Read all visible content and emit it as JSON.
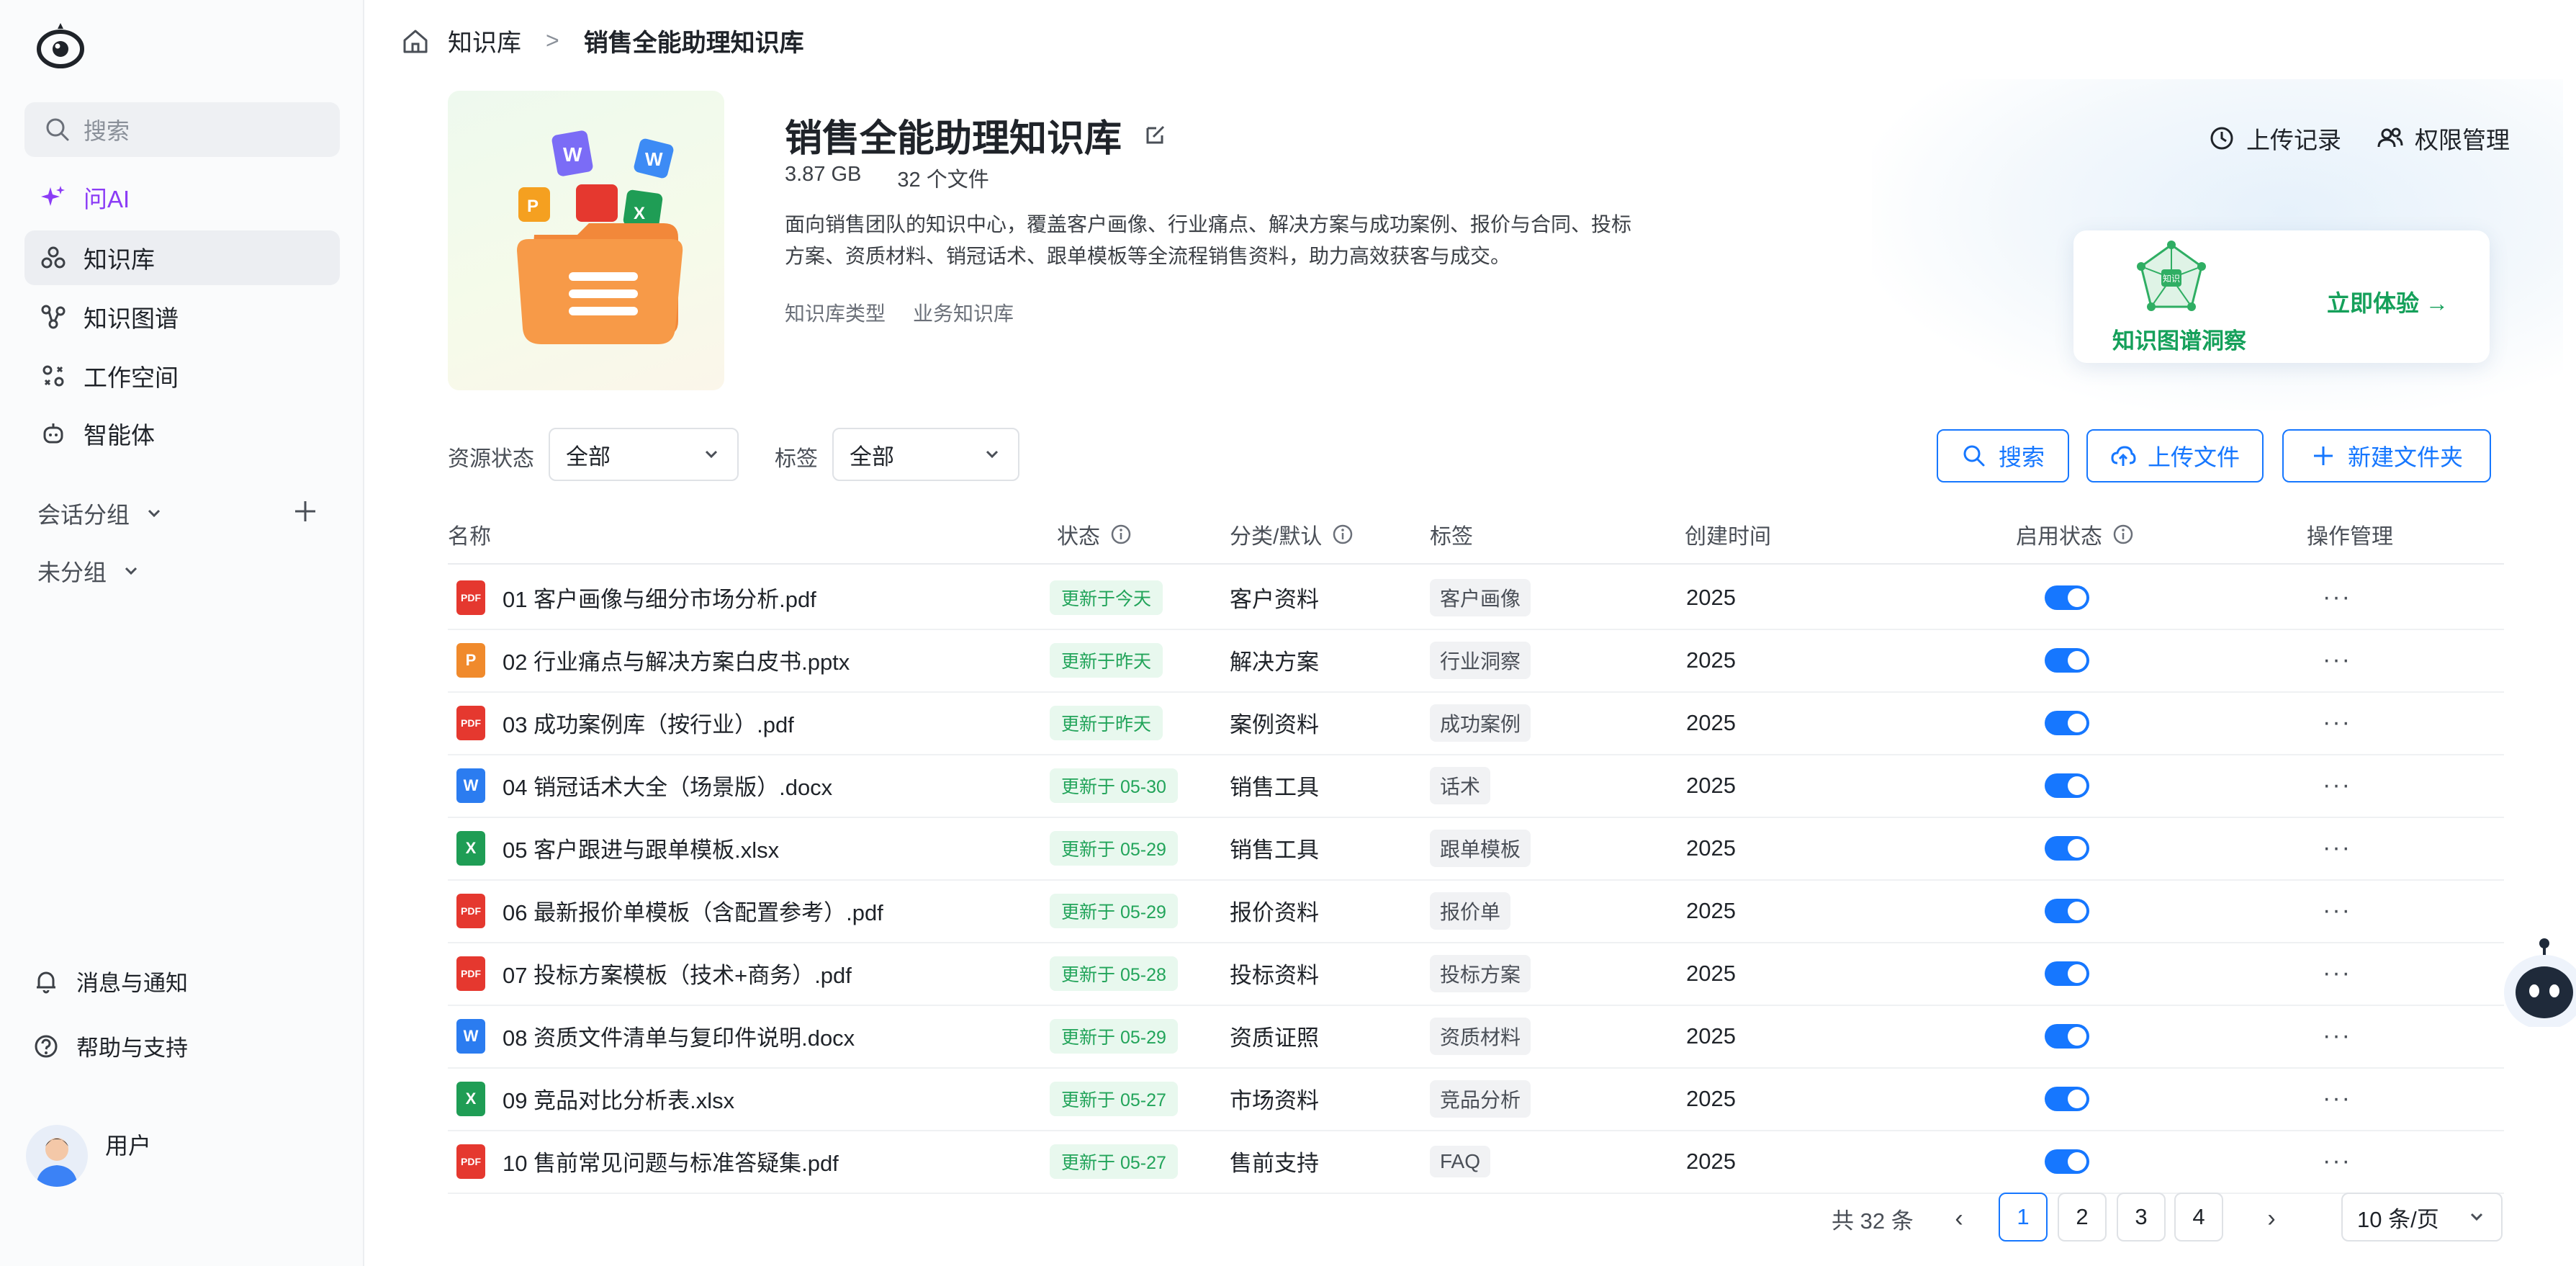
{
  "sidebar": {
    "search_placeholder": "搜索",
    "items": [
      {
        "label": "问AI",
        "icon": "sparkle-icon"
      },
      {
        "label": "知识库",
        "icon": "knowledge-base-icon"
      },
      {
        "label": "知识图谱",
        "icon": "graph-icon"
      },
      {
        "label": "工作空间",
        "icon": "workspace-icon"
      },
      {
        "label": "智能体",
        "icon": "agent-icon"
      }
    ],
    "groups": [
      {
        "label": "会话分组"
      },
      {
        "label": "未分组"
      }
    ],
    "bottom": [
      {
        "label": "消息与通知",
        "icon": "bell-icon"
      },
      {
        "label": "帮助与支持",
        "icon": "help-icon"
      }
    ],
    "user_name": "用户"
  },
  "breadcrumb": {
    "root": "知识库",
    "separator": ">",
    "current": "销售全能助理知识库"
  },
  "kb": {
    "title": "销售全能助理知识库",
    "size": "3.87 GB",
    "file_count": "32 个文件",
    "description": "面向销售团队的知识中心，覆盖客户画像、行业痛点、解决方案与成功案例、报价与合同、投标方案、资质材料、销冠话术、跟单模板等全流程销售资料，助力高效获客与成交。",
    "type_label": "知识库类型",
    "type_value": "业务知识库",
    "upload_history": "上传记录",
    "permissions": "权限管理",
    "graph_card_label": "知识图谱洞察",
    "graph_card_cta": "立即体验 →",
    "graph_card_center": "知识"
  },
  "filters": {
    "status_label": "资源状态",
    "status_value": "全部",
    "tag_label": "标签",
    "tag_value": "全部"
  },
  "actions": {
    "search": "搜索",
    "upload": "上传文件",
    "new_folder": "新建文件夹"
  },
  "table": {
    "headers": {
      "name": "名称",
      "status": "状态",
      "category": "分类/默认",
      "tag": "标签",
      "created": "创建时间",
      "enabled": "启用状态",
      "ops": "操作管理"
    },
    "rows": [
      {
        "name": "01 客户画像与细分市场分析.pdf",
        "type": "pdf",
        "status": "更新于今天",
        "category": "客户资料",
        "tag": "客户画像",
        "created": "2025",
        "enabled": true
      },
      {
        "name": "02 行业痛点与解决方案白皮书.pptx",
        "type": "pptx",
        "status": "更新于昨天",
        "category": "解决方案",
        "tag": "行业洞察",
        "created": "2025",
        "enabled": true
      },
      {
        "name": "03 成功案例库（按行业）.pdf",
        "type": "pdf",
        "status": "更新于昨天",
        "category": "案例资料",
        "tag": "成功案例",
        "created": "2025",
        "enabled": true
      },
      {
        "name": "04 销冠话术大全（场景版）.docx",
        "type": "docx",
        "status": "更新于 05-30",
        "category": "销售工具",
        "tag": "话术",
        "created": "2025",
        "enabled": true
      },
      {
        "name": "05 客户跟进与跟单模板.xlsx",
        "type": "xlsx",
        "status": "更新于 05-29",
        "category": "销售工具",
        "tag": "跟单模板",
        "created": "2025",
        "enabled": true
      },
      {
        "name": "06 最新报价单模板（含配置参考）.pdf",
        "type": "pdf",
        "status": "更新于 05-29",
        "category": "报价资料",
        "tag": "报价单",
        "created": "2025",
        "enabled": true
      },
      {
        "name": "07 投标方案模板（技术+商务）.pdf",
        "type": "pdf",
        "status": "更新于 05-28",
        "category": "投标资料",
        "tag": "投标方案",
        "created": "2025",
        "enabled": true
      },
      {
        "name": "08 资质文件清单与复印件说明.docx",
        "type": "docx",
        "status": "更新于 05-29",
        "category": "资质证照",
        "tag": "资质材料",
        "created": "2025",
        "enabled": true
      },
      {
        "name": "09 竞品对比分析表.xlsx",
        "type": "xlsx",
        "status": "更新于 05-27",
        "category": "市场资料",
        "tag": "竞品分析",
        "created": "2025",
        "enabled": true
      },
      {
        "name": "10 售前常见问题与标准答疑集.pdf",
        "type": "pdf",
        "status": "更新于 05-27",
        "category": "售前支持",
        "tag": "FAQ",
        "created": "2025",
        "enabled": true
      }
    ],
    "ops_symbol": "···"
  },
  "pagination": {
    "total": "共 32 条",
    "pages": [
      "1",
      "2",
      "3",
      "4"
    ],
    "current": "1",
    "prev": "‹",
    "next": "›",
    "page_size": "10 条/页"
  },
  "file_badges": {
    "pdf": "PDF",
    "pptx": "P",
    "docx": "W",
    "xlsx": "X"
  },
  "colors": {
    "accent": "#1677ff",
    "ai_purple": "#8b3cf6",
    "success_green": "#22a45a",
    "pdf_red": "#e5382f",
    "pptx_orange": "#f08a2c",
    "docx_blue": "#2b7cf0",
    "xlsx_green": "#1f9d55"
  }
}
